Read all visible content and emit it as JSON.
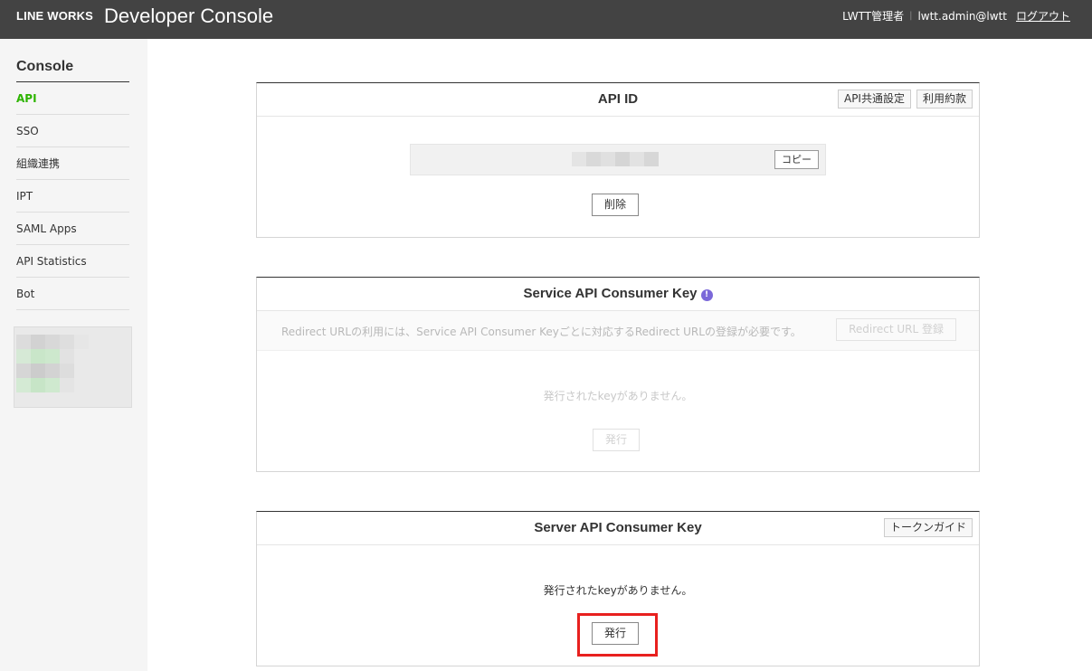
{
  "header": {
    "brand": "LINE WORKS",
    "title": "Developer Console",
    "org_name": "LWTT管理者",
    "user_email": "lwtt.admin@lwtt",
    "logout": "ログアウト"
  },
  "sidebar": {
    "title": "Console",
    "items": [
      {
        "label": "API",
        "active": true
      },
      {
        "label": "SSO"
      },
      {
        "label": "組織連携"
      },
      {
        "label": "IPT"
      },
      {
        "label": "SAML Apps"
      },
      {
        "label": "API Statistics"
      },
      {
        "label": "Bot"
      }
    ],
    "accent_color": "#2db400"
  },
  "api_id_card": {
    "title": "API ID",
    "buttons": [
      "API共通設定",
      "利用約款"
    ],
    "copy_label": "コピー",
    "delete_label": "削除"
  },
  "service_key_card": {
    "title": "Service API Consumer Key",
    "info_icon": "info-icon",
    "notice": "Redirect URLの利用には、Service API Consumer Keyごとに対応するRedirect URLの登録が必要です。",
    "redirect_button": "Redirect URL 登録",
    "empty_message": "発行されたkeyがありません。",
    "issue_label": "発行"
  },
  "server_key_card": {
    "title": "Server API Consumer Key",
    "guide_button": "トークンガイド",
    "empty_message": "発行されたkeyがありません。",
    "issue_label": "発行",
    "highlight_color": "#e8201e"
  }
}
